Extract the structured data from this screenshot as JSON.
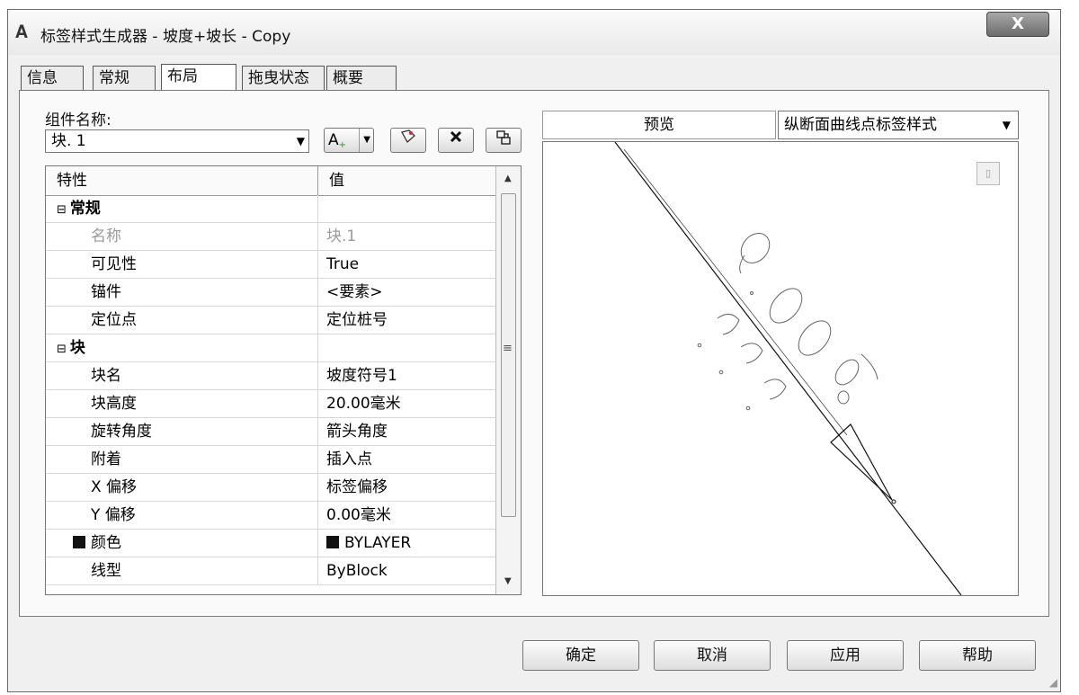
{
  "window": {
    "title": "标签样式生成器 - 坡度+坡长 - Copy",
    "close_label": "X"
  },
  "tabs": [
    {
      "label": "信息"
    },
    {
      "label": "常规"
    },
    {
      "label": "布局"
    },
    {
      "label": "拖曳状态"
    },
    {
      "label": "概要"
    }
  ],
  "active_tab": "布局",
  "component": {
    "label": "组件名称:",
    "selected": "块. 1",
    "toolbar": {
      "text_tool_label": "A",
      "text_tool_suffix": "+"
    }
  },
  "grid": {
    "headers": {
      "property": "特性",
      "value": "值"
    },
    "rows": [
      {
        "type": "group",
        "label": "常规",
        "value": ""
      },
      {
        "type": "item",
        "label": "名称",
        "value": "块.1",
        "dim": true
      },
      {
        "type": "item",
        "label": "可见性",
        "value": "True"
      },
      {
        "type": "item",
        "label": "锚件",
        "value": "<要素>"
      },
      {
        "type": "item",
        "label": "定位点",
        "value": "定位桩号"
      },
      {
        "type": "group",
        "label": "块",
        "value": ""
      },
      {
        "type": "item",
        "label": "块名",
        "value": "坡度符号1"
      },
      {
        "type": "item",
        "label": "块高度",
        "value": "20.00毫米"
      },
      {
        "type": "item",
        "label": "旋转角度",
        "value": "箭头角度"
      },
      {
        "type": "item",
        "label": "附着",
        "value": "插入点"
      },
      {
        "type": "item",
        "label": "X 偏移",
        "value": "标签偏移"
      },
      {
        "type": "item",
        "label": "Y 偏移",
        "value": "0.00毫米"
      },
      {
        "type": "item",
        "label": "颜色",
        "value": "BYLAYER",
        "swatch": true
      },
      {
        "type": "item",
        "label": "线型",
        "value": "ByBlock"
      }
    ]
  },
  "preview": {
    "label": "预览",
    "style_selected": "纵断面曲线点标签样式"
  },
  "buttons": {
    "ok": "确定",
    "cancel": "取消",
    "apply": "应用",
    "help": "帮助"
  }
}
